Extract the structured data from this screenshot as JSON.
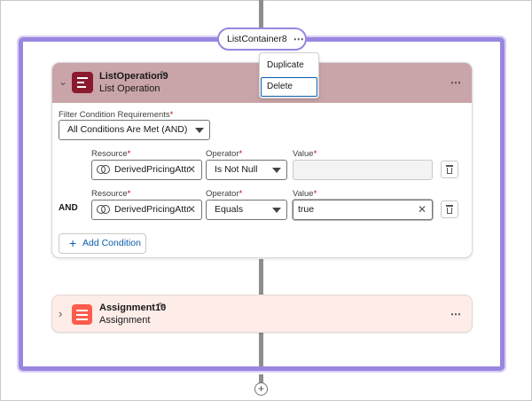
{
  "container": {
    "label": "ListContainer8",
    "more": "⋯"
  },
  "menu": {
    "duplicate": "Duplicate",
    "delete": "Delete"
  },
  "list_operation": {
    "title": "ListOperation9",
    "subtitle": "List Operation",
    "filter_label": "Filter Condition Requirements",
    "filter_value": "All Conditions Are Met (AND)",
    "conditions": [
      {
        "prefix": "",
        "resource_label": "Resource",
        "resource_value": "DerivedPricingAttr",
        "operator_label": "Operator",
        "operator_value": "Is Not Null",
        "value_label": "Value",
        "value": ""
      },
      {
        "prefix": "AND",
        "resource_label": "Resource",
        "resource_value": "DerivedPricingAttr",
        "operator_label": "Operator",
        "operator_value": "Equals",
        "value_label": "Value",
        "value": "true"
      }
    ],
    "add_condition": "Add Condition",
    "required_mark": "*",
    "clear_glyph": "✕"
  },
  "assignment": {
    "title": "Assignment10",
    "subtitle": "Assignment"
  },
  "glyphs": {
    "chevron_down": "⌵",
    "chevron_right": "›",
    "pencil": "✎",
    "more": "⋯",
    "plus": "+"
  },
  "colors": {
    "accent_purple": "#9a86e0",
    "list_op_header": "#c9a4a8",
    "list_op_icon": "#8b1a2e",
    "assignment_bg": "#fdece8",
    "assignment_icon": "#fe5c4c",
    "link_blue": "#0b5cab"
  },
  "icons": [
    "list-operation-icon",
    "assignment-icon",
    "resource-icon",
    "trash-icon",
    "add-icon",
    "edit-pencil-icon",
    "chevron-icon",
    "more-actions-icon"
  ]
}
